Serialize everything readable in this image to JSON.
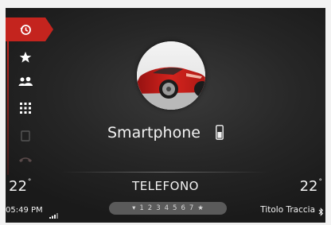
{
  "rail": {
    "items": [
      {
        "name": "recent-calls",
        "icon": "history-icon",
        "active": true
      },
      {
        "name": "favorites",
        "icon": "star-icon"
      },
      {
        "name": "contacts",
        "icon": "contacts-icon"
      },
      {
        "name": "keypad",
        "icon": "keypad-icon"
      }
    ]
  },
  "device": {
    "name": "Smartphone"
  },
  "header": {
    "title": "TELEFONO"
  },
  "climate": {
    "left_temp": "22",
    "right_temp": "22",
    "degree": "°"
  },
  "status": {
    "clock": "05:49 PM",
    "track": "Titolo Traccia"
  },
  "pager": {
    "prefix": "▾",
    "pages": [
      "1",
      "2",
      "3",
      "4",
      "5",
      "6",
      "7"
    ],
    "favorite": "★"
  },
  "colors": {
    "accent": "#c4241e",
    "background": "#262626",
    "text": "#f2f2f2"
  }
}
